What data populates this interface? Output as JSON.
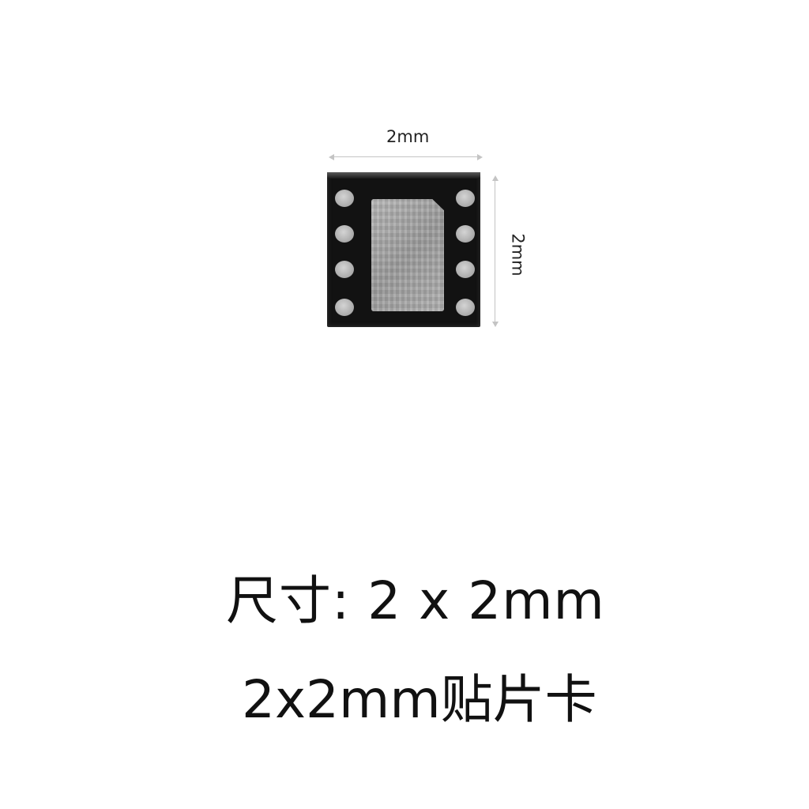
{
  "dimensions": {
    "width_label": "2mm",
    "height_label": "2mm"
  },
  "captions": {
    "size": "尺寸: 2 x 2mm",
    "product": "2x2mm贴片卡"
  },
  "colors": {
    "background": "#ffffff",
    "chip_body": "#121212",
    "pad_metal": "#b5b5b5",
    "dimension_line": "#c4c4c4",
    "text": "#111111"
  }
}
